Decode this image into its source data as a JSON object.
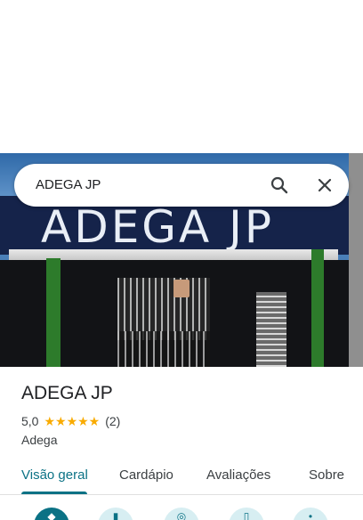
{
  "search": {
    "query": "ADEGA JP",
    "search_icon": "search-icon",
    "close_icon": "close-icon"
  },
  "photo": {
    "sign_text": "ADEGA JP"
  },
  "place": {
    "name": "ADEGA JP",
    "rating": "5,0",
    "stars": "★★★★★",
    "review_count": "(2)",
    "category": "Adega"
  },
  "tabs": [
    {
      "label": "Visão geral",
      "active": true
    },
    {
      "label": "Cardápio",
      "active": false
    },
    {
      "label": "Avaliações",
      "active": false
    },
    {
      "label": "Sobre",
      "active": false
    }
  ],
  "actions": [
    {
      "icon": "directions-icon"
    },
    {
      "icon": "save-icon"
    },
    {
      "icon": "nearby-icon"
    },
    {
      "icon": "send-to-phone-icon"
    },
    {
      "icon": "share-icon"
    }
  ],
  "colors": {
    "accent": "#0b7285",
    "star": "#f9ab00",
    "sign_background": "#15234a"
  }
}
